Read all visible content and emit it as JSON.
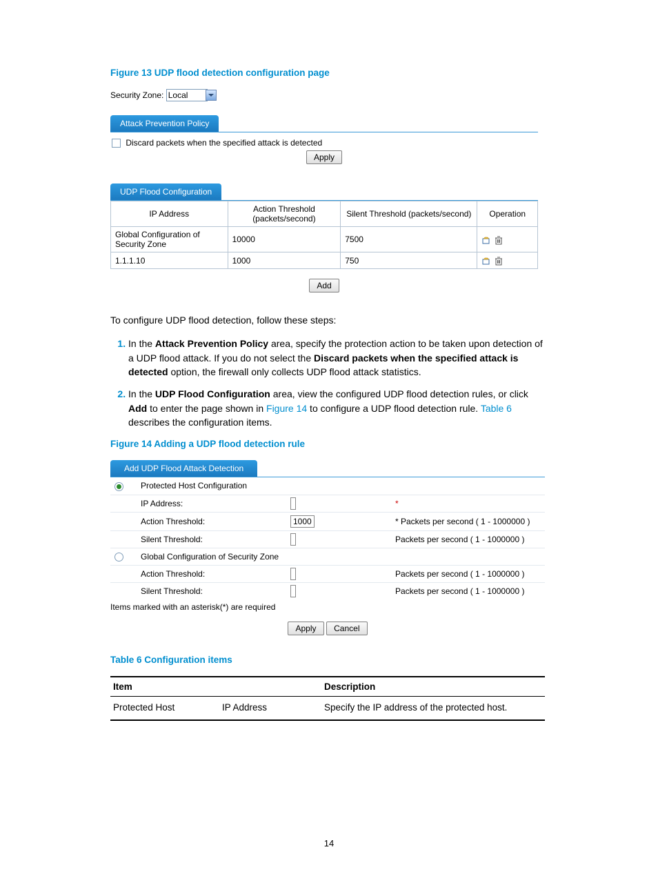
{
  "figure13": {
    "caption": "Figure 13 UDP flood detection configuration page",
    "security_zone_label": "Security Zone:",
    "security_zone_value": "Local",
    "policy_tab": "Attack Prevention Policy",
    "discard_label": "Discard packets when the specified attack is detected",
    "apply_btn": "Apply",
    "config_tab": "UDP Flood Configuration",
    "headers": {
      "ip": "IP Address",
      "action": "Action Threshold (packets/second)",
      "silent": "Silent Threshold (packets/second)",
      "op": "Operation"
    },
    "rows": [
      {
        "ip": "Global Configuration of Security Zone",
        "action": "10000",
        "silent": "7500"
      },
      {
        "ip": "1.1.1.10",
        "action": "1000",
        "silent": "750"
      }
    ],
    "add_btn": "Add"
  },
  "intro": "To configure UDP flood detection, follow these steps:",
  "step1": {
    "pre": "In the ",
    "b1": "Attack Prevention Policy",
    "mid1": " area, specify the protection action to be taken upon detection of a UDP flood attack. If you do not select the ",
    "b2": "Discard packets when the specified attack is detected",
    "mid2": " option, the firewall only collects UDP flood attack statistics."
  },
  "step2": {
    "pre": "In the ",
    "b1": "UDP Flood Configuration",
    "mid1": " area, view the configured UDP flood detection rules, or click ",
    "b2": "Add",
    "mid2": " to enter the page shown in ",
    "link1": "Figure 14",
    "mid3": " to configure a UDP flood detection rule. ",
    "link2": "Table 6",
    "mid4": " describes the configuration items."
  },
  "figure14": {
    "caption": "Figure 14 Adding a UDP flood detection rule",
    "tab": "Add UDP Flood Attack Detection",
    "opt1": "Protected Host Configuration",
    "ip_label": "IP Address:",
    "ip_hint": "*",
    "at_label": "Action Threshold:",
    "at_value": "1000",
    "at_hint": "* Packets per second ( 1 - 1000000 )",
    "st_label": "Silent Threshold:",
    "st_hint": "Packets per second ( 1 - 1000000 )",
    "opt2": "Global Configuration of Security Zone",
    "g_at_label": "Action Threshold:",
    "g_at_hint": "Packets per second ( 1 - 1000000 )",
    "g_st_label": "Silent Threshold:",
    "g_st_hint": "Packets per second ( 1 - 1000000 )",
    "required_note": "Items marked with an asterisk(*) are required",
    "apply_btn": "Apply",
    "cancel_btn": "Cancel"
  },
  "table6": {
    "caption": "Table 6 Configuration items",
    "h_item": "Item",
    "h_desc": "Description",
    "row": {
      "c1": "Protected Host",
      "c2": "IP Address",
      "c3": "Specify the IP address of the protected host."
    }
  },
  "pagenum": "14"
}
